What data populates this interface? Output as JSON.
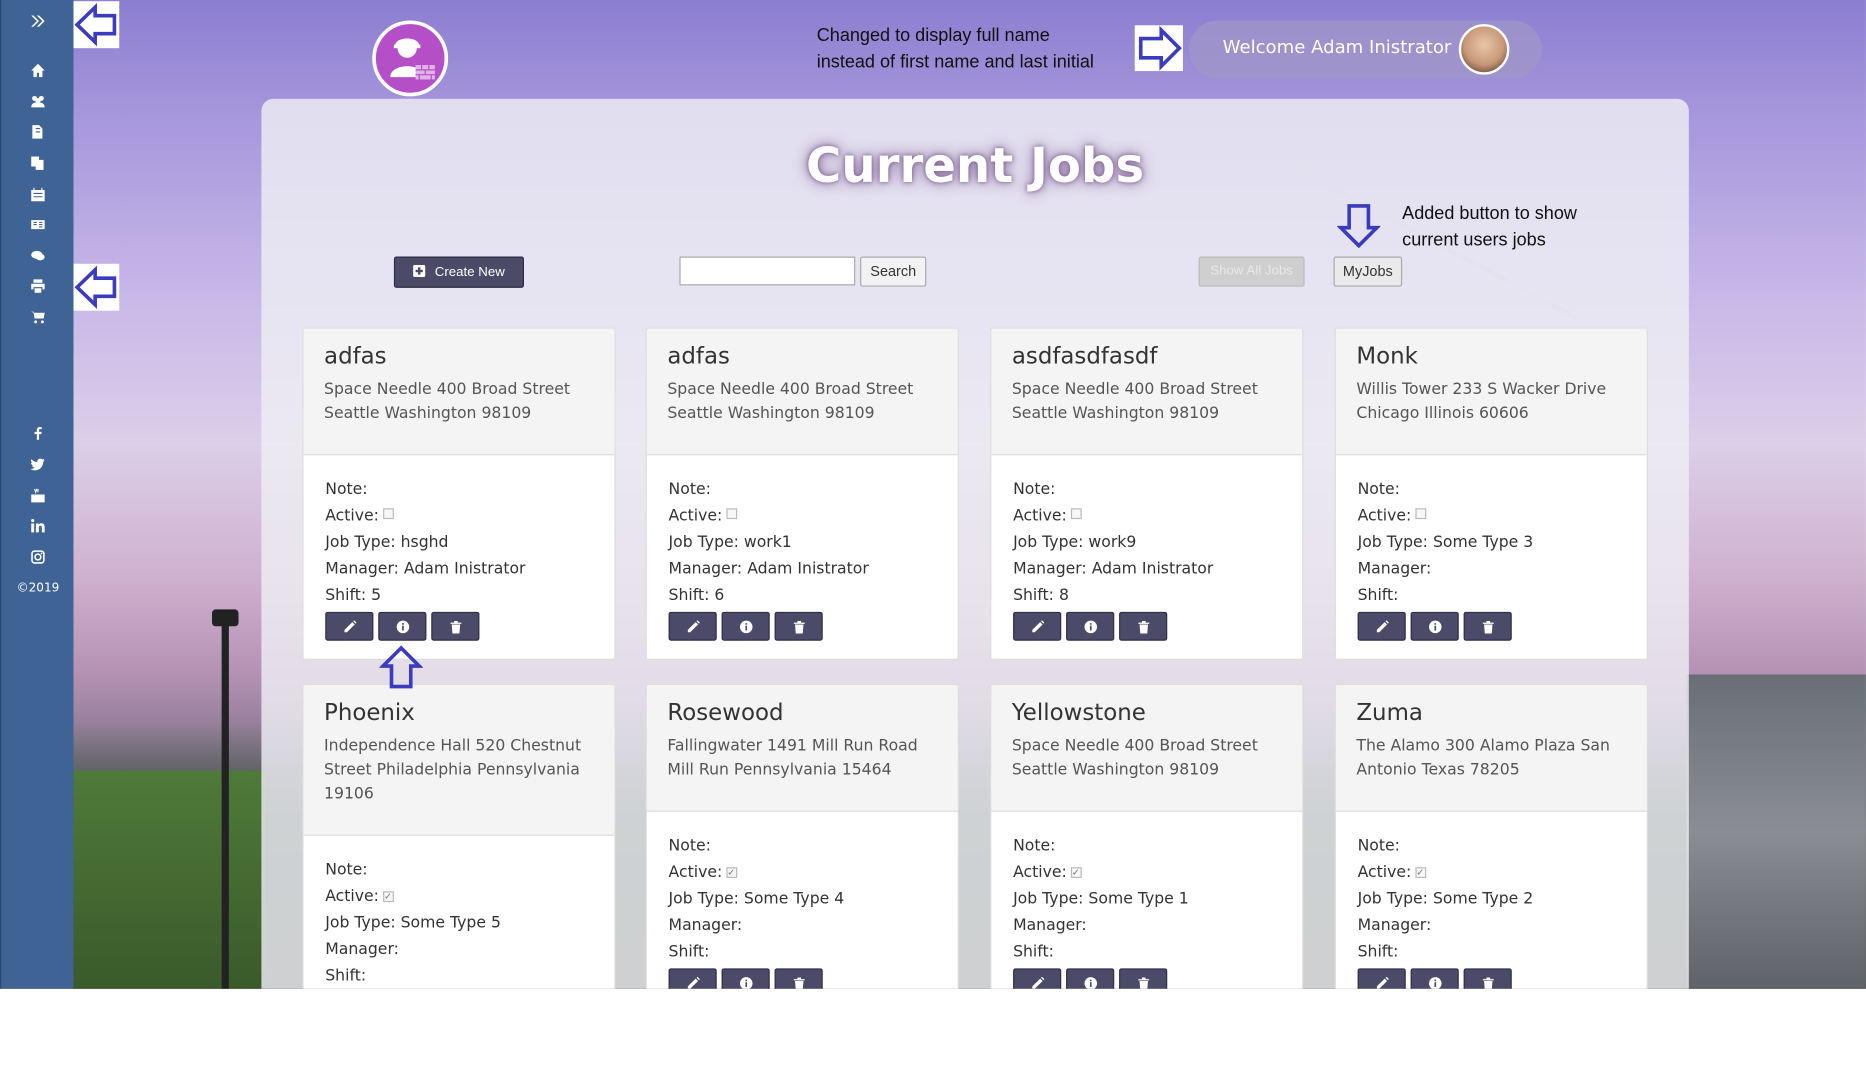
{
  "sidebar": {
    "toggle_icon": "double-chevron-right-icon",
    "nav_icons": [
      "home-icon",
      "users-icon",
      "files-icon",
      "copy-icon",
      "calendar-icon",
      "id-card-icon",
      "comments-icon",
      "print-icon",
      "cart-icon"
    ],
    "social_icons": [
      "facebook-icon",
      "twitter-icon",
      "youtube-icon",
      "linkedin-icon",
      "instagram-icon"
    ],
    "copyright": "©2019"
  },
  "annotations": {
    "header_note": "Changed to display full name\ninstead of first name and last initial",
    "myjobs_note": "Added button to show\ncurrent users jobs"
  },
  "header": {
    "welcome_text": "Welcome Adam Inistrator"
  },
  "main": {
    "title": "Current Jobs",
    "create_label": "Create New",
    "search_placeholder": "",
    "search_label": "Search",
    "show_all_label": "Show All Jobs",
    "my_jobs_label": "MyJobs"
  },
  "labels": {
    "note": "Note:",
    "active": "Active:",
    "job_type": "Job Type:",
    "manager": "Manager:",
    "shift": "Shift:"
  },
  "jobs": [
    {
      "name": "adfas",
      "address": "Space Needle 400 Broad Street Seattle Washington 98109",
      "note": "",
      "active": false,
      "job_type": "hsghd",
      "manager": "Adam Inistrator",
      "shift": "5"
    },
    {
      "name": "adfas",
      "address": "Space Needle 400 Broad Street Seattle Washington 98109",
      "note": "",
      "active": false,
      "job_type": "work1",
      "manager": "Adam Inistrator",
      "shift": "6"
    },
    {
      "name": "asdfasdfasdf",
      "address": "Space Needle 400 Broad Street Seattle Washington 98109",
      "note": "",
      "active": false,
      "job_type": "work9",
      "manager": "Adam Inistrator",
      "shift": "8"
    },
    {
      "name": "Monk",
      "address": "Willis Tower 233 S Wacker Drive Chicago Illinois 60606",
      "note": "",
      "active": false,
      "job_type": "Some Type 3",
      "manager": "",
      "shift": ""
    },
    {
      "name": "Phoenix",
      "address": "Independence Hall 520 Chestnut Street Philadelphia Pennsylvania 19106",
      "note": "",
      "active": true,
      "job_type": "Some Type 5",
      "manager": "",
      "shift": ""
    },
    {
      "name": "Rosewood",
      "address": "Fallingwater 1491 Mill Run Road Mill Run Pennsylvania 15464",
      "note": "",
      "active": true,
      "job_type": "Some Type 4",
      "manager": "",
      "shift": ""
    },
    {
      "name": "Yellowstone",
      "address": "Space Needle 400 Broad Street Seattle Washington 98109",
      "note": "",
      "active": true,
      "job_type": "Some Type 1",
      "manager": "",
      "shift": ""
    },
    {
      "name": "Zuma",
      "address": "The Alamo 300 Alamo Plaza San Antonio Texas 78205",
      "note": "",
      "active": true,
      "job_type": "Some Type 2",
      "manager": "",
      "shift": ""
    }
  ],
  "card_action_icons": [
    "pencil-icon",
    "info-icon",
    "trash-icon"
  ],
  "colors": {
    "sidebar": "#3e6394",
    "button_dark": "#4c4a69",
    "logo": "#b44fc7",
    "annotation_arrow": "#3b3bbd"
  }
}
